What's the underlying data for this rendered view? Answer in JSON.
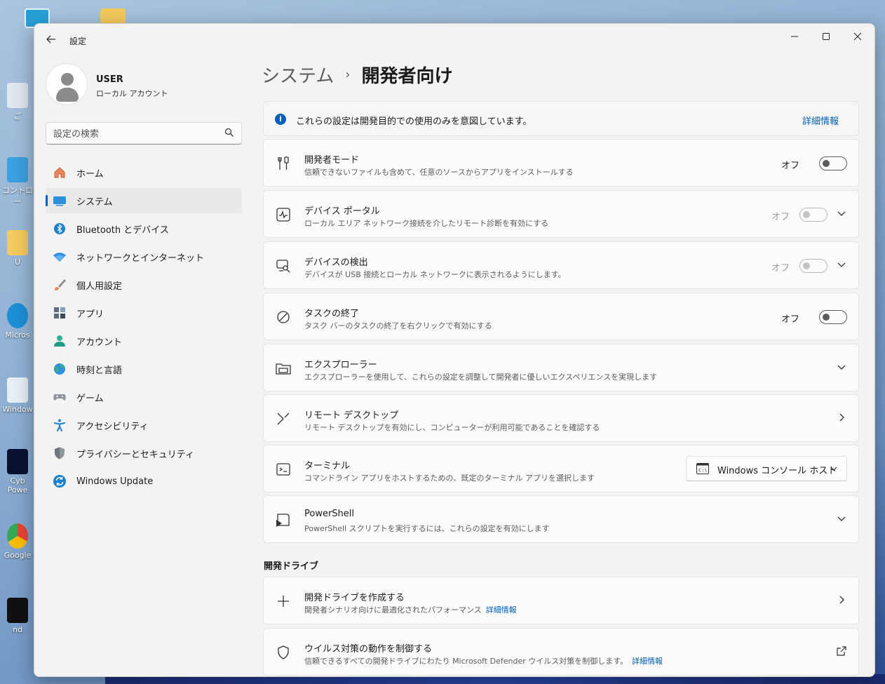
{
  "desktop": {
    "icons": [
      "ご",
      "コントロー",
      "U",
      "Micros",
      "Window",
      "Cyb Powe",
      "Google",
      "nd"
    ]
  },
  "window": {
    "app_title": "設定",
    "controls": {
      "minimize": "—",
      "maximize": "☐",
      "close": "✕"
    }
  },
  "profile": {
    "name": "USER",
    "account_type": "ローカル アカウント"
  },
  "search": {
    "placeholder": "設定の検索"
  },
  "sidebar": {
    "items": [
      {
        "label": "ホーム",
        "icon": "home-icon"
      },
      {
        "label": "システム",
        "icon": "system-icon",
        "active": true
      },
      {
        "label": "Bluetooth とデバイス",
        "icon": "bluetooth-icon"
      },
      {
        "label": "ネットワークとインターネット",
        "icon": "wifi-icon"
      },
      {
        "label": "個人用設定",
        "icon": "brush-icon"
      },
      {
        "label": "アプリ",
        "icon": "apps-icon"
      },
      {
        "label": "アカウント",
        "icon": "account-icon"
      },
      {
        "label": "時刻と言語",
        "icon": "globe-icon"
      },
      {
        "label": "ゲーム",
        "icon": "gamepad-icon"
      },
      {
        "label": "アクセシビリティ",
        "icon": "accessibility-icon"
      },
      {
        "label": "プライバシーとセキュリティ",
        "icon": "shield-icon"
      },
      {
        "label": "Windows Update",
        "icon": "update-icon"
      }
    ]
  },
  "breadcrumb": {
    "parent": "システム",
    "separator": "›",
    "current": "開発者向け"
  },
  "info_banner": {
    "text": "これらの設定は開発目的での使用のみを意図しています。",
    "link": "詳細情報",
    "icon_glyph": "i"
  },
  "settings": {
    "developer_mode": {
      "title": "開発者モード",
      "subtitle": "信頼できないファイルも含めて、任意のソースからアプリをインストールする",
      "state": "オフ"
    },
    "device_portal": {
      "title": "デバイス ポータル",
      "subtitle": "ローカル エリア ネットワーク接続を介したリモート診断を有効にする",
      "state": "オフ"
    },
    "device_discovery": {
      "title": "デバイスの検出",
      "subtitle": "デバイスが USB 接続とローカル ネットワークに表示されるようにします。",
      "state": "オフ"
    },
    "end_task": {
      "title": "タスクの終了",
      "subtitle": "タスク バーのタスクの終了を右クリックで有効にする",
      "state": "オフ"
    },
    "file_explorer": {
      "title": "エクスプローラー",
      "subtitle": "エクスプローラーを使用して、これらの設定を調整して開発者に優しいエクスペリエンスを実現します"
    },
    "remote_desktop": {
      "title": "リモート デスクトップ",
      "subtitle": "リモート デスクトップを有効にし、コンピューターが利用可能であることを確認する"
    },
    "terminal": {
      "title": "ターミナル",
      "subtitle": "コマンドライン アプリをホストするための、既定のターミナル アプリを選択します",
      "selected": "Windows コンソール ホスト",
      "dd_icon_text": "C:\\"
    },
    "powershell": {
      "title": "PowerShell",
      "subtitle": "PowerShell スクリプトを実行するには、これらの設定を有効にします"
    }
  },
  "dev_drive": {
    "section_title": "開発ドライブ",
    "create": {
      "title": "開発ドライブを作成する",
      "subtitle": "開発者シナリオ向けに最適化されたパフォーマンス",
      "link": "詳細情報"
    },
    "antivirus": {
      "title": "ウイルス対策の動作を制御する",
      "subtitle": "信頼できるすべての開発ドライブにわたり Microsoft Defender ウイルス対策を制御します。",
      "link": "詳細情報"
    }
  },
  "colors": {
    "accent": "#005fb8",
    "window_bg": "#f3f3f3",
    "card_bg": "#fbfbfb"
  }
}
